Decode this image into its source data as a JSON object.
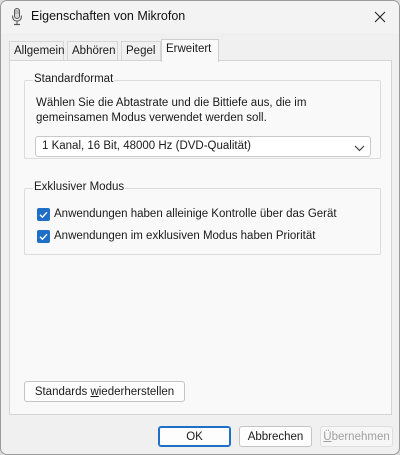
{
  "window": {
    "title": "Eigenschaften von Mikrofon",
    "title_icon": "microphone-icon",
    "close_icon": "close-icon"
  },
  "tabs": [
    {
      "label": "Allgemein",
      "active": false
    },
    {
      "label": "Abhören",
      "active": false
    },
    {
      "label": "Pegel",
      "active": false
    },
    {
      "label": "Erweitert",
      "active": true
    }
  ],
  "standardformat": {
    "legend": "Standardformat",
    "description_line1": "Wählen Sie die Abtastrate und die Bittiefe aus, die im",
    "description_line2": "gemeinsamen Modus verwendet werden soll.",
    "selected_format": "1 Kanal, 16 Bit, 48000 Hz (DVD-Qualität)",
    "dropdown_icon": "chevron-down-icon"
  },
  "exclusive_mode": {
    "legend": "Exklusiver Modus",
    "options": [
      {
        "label": "Anwendungen haben alleinige Kontrolle über das Gerät",
        "checked": true
      },
      {
        "label": "Anwendungen im exklusiven Modus haben Priorität",
        "checked": true
      }
    ]
  },
  "restore_button": {
    "label_before": "Standards ",
    "label_mnemonic": "w",
    "label_after": "iederherstellen"
  },
  "footer": {
    "ok": "OK",
    "cancel": "Abbrechen",
    "apply_mnemonic": "Ü",
    "apply_rest": "bernehmen"
  },
  "colors": {
    "accent": "#1e6fc8",
    "window_bg": "#f0f0f0",
    "panel_bg": "#f9f9f9"
  }
}
